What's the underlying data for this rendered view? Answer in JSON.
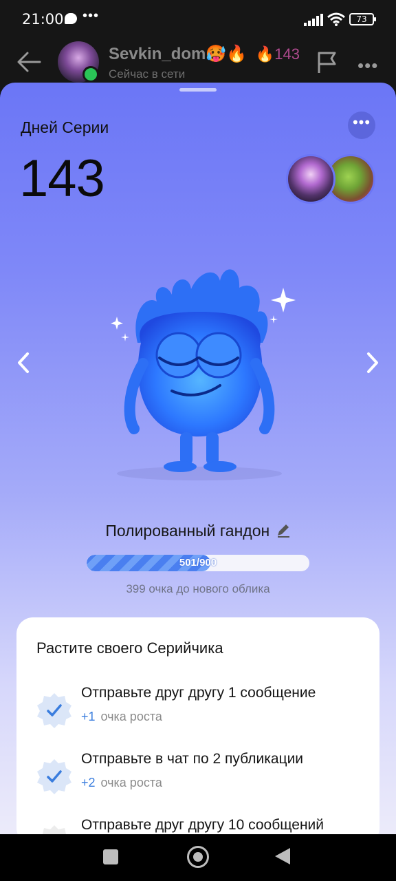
{
  "status_bar": {
    "time": "21:00",
    "battery": "73"
  },
  "chat_header": {
    "name": "Sevkin_dom🥵🔥",
    "streak_badge": "🔥143",
    "status": "Сейчас в сети"
  },
  "streak": {
    "label": "Дней Серии",
    "count": "143"
  },
  "avatar": {
    "name": "Полированный гандон",
    "progress_text": "501/900",
    "progress_fraction": 0.5567,
    "points_left": "399 очка до нового облика"
  },
  "tasks_card": {
    "title": "Растите своего Серийчика",
    "tasks": [
      {
        "title": "Отправьте друг другу 1 сообщение",
        "points": "+1",
        "unit": "очка роста"
      },
      {
        "title": "Отправьте в чат по 2 публикации",
        "points": "+2",
        "unit": "очка роста"
      },
      {
        "title": "Отправьте друг другу 10 сообщений",
        "points": "",
        "unit": ""
      }
    ]
  },
  "colors": {
    "accent": "#3a7dde",
    "sheet_top": "#6b76f6",
    "online": "#2ac457"
  },
  "icons": {
    "back": "arrow-left-icon",
    "flag": "flag-icon",
    "more": "more-horizontal-icon",
    "edit": "pencil-icon",
    "check": "check-badge-icon"
  }
}
